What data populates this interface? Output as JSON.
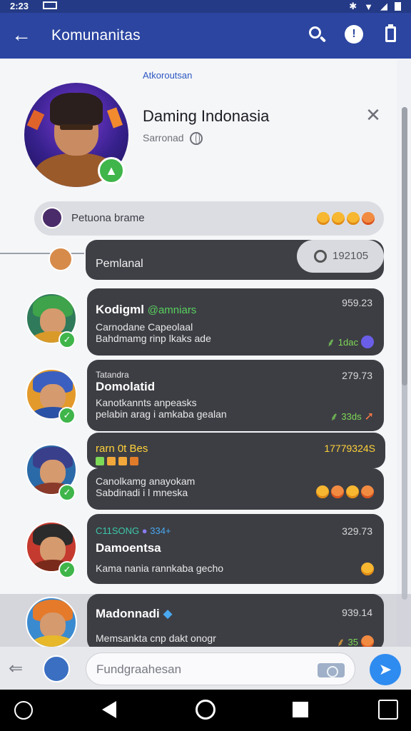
{
  "status_bar": {
    "time": "2:23"
  },
  "app_bar": {
    "title": "Komunanitas",
    "back_icon": "arrow-left-icon",
    "search_icon": "search-icon",
    "info_icon": "info-icon",
    "more_icon": "clipboard-icon"
  },
  "header": {
    "tag": "Atkoroutsan",
    "group_name": "Daming Indonasia",
    "group_sub": "Sarronad"
  },
  "pinned": {
    "label": "Petuona  brame"
  },
  "general": {
    "label": "Pemlanal",
    "count": "192105"
  },
  "messages": [
    {
      "name": "Kodigml",
      "tagline": "@amniars",
      "line1": "Carnodane Capeolaal",
      "line2": "Bahdmamg rinp lkaks ade",
      "time": "959.23",
      "react_count": "1dac"
    },
    {
      "small": "Tatandra",
      "name": "Domolatid",
      "line1": "Kanotkannts anpeasks",
      "line2": "pelabin arag i amkaba gealan",
      "time": "279.73",
      "react_count": "33ds"
    },
    {
      "title": "rarn 0t Bes",
      "time": "17779324S",
      "line1": "Canolkamg anayokam",
      "line2": "Sabdinadi i l mneska"
    },
    {
      "header": "C11SONG",
      "header_tail": "334+",
      "name": "Damoentsa",
      "line1": "Kama nania rannkaba gecho",
      "time": "329.73"
    },
    {
      "name": "Madonnadi",
      "line1": "Memsankta cnp dakt onogr",
      "time": "939.14",
      "react_count": "35"
    }
  ],
  "composer": {
    "placeholder": "Fundgraahesan"
  },
  "colors": {
    "primary": "#2b45a0",
    "bubble": "#3d3e44",
    "accent_green": "#3fb54a",
    "send": "#2e8bf0"
  }
}
